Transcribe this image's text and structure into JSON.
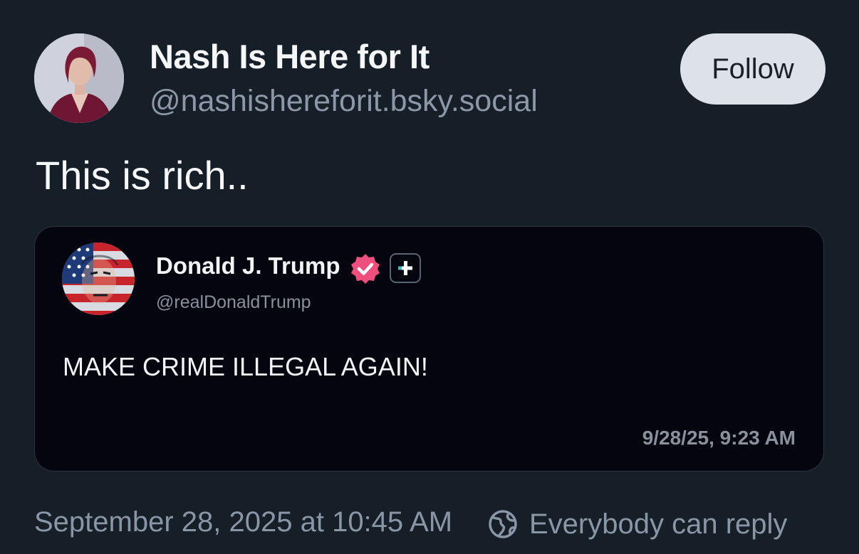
{
  "author": {
    "name": "Nash Is Here for It",
    "handle": "@nashishereforit.bsky.social",
    "avatar_icon": "profile-photo"
  },
  "follow_label": "Follow",
  "post_text": "This is rich..",
  "quoted_post": {
    "author_name": "Donald J. Trump",
    "author_handle": "@realDonaldTrump",
    "avatar_icon": "flag-portrait-avatar",
    "badges": [
      "verified-badge-icon",
      "plus-badge-icon"
    ],
    "text": "MAKE CRIME ILLEGAL AGAIN!",
    "timestamp": "9/28/25, 9:23 AM"
  },
  "post_timestamp": "September 28, 2025 at 10:45 AM",
  "reply_settings": {
    "label": "Everybody can reply",
    "icon": "globe-icon"
  },
  "colors": {
    "background": "#161e27",
    "quote_background": "#04050f",
    "follow_button": "#dde2ea",
    "verified_badge": "#ee4f7c",
    "plus_badge_accent": "#2cc5c0",
    "muted_text": "#8996a5"
  }
}
